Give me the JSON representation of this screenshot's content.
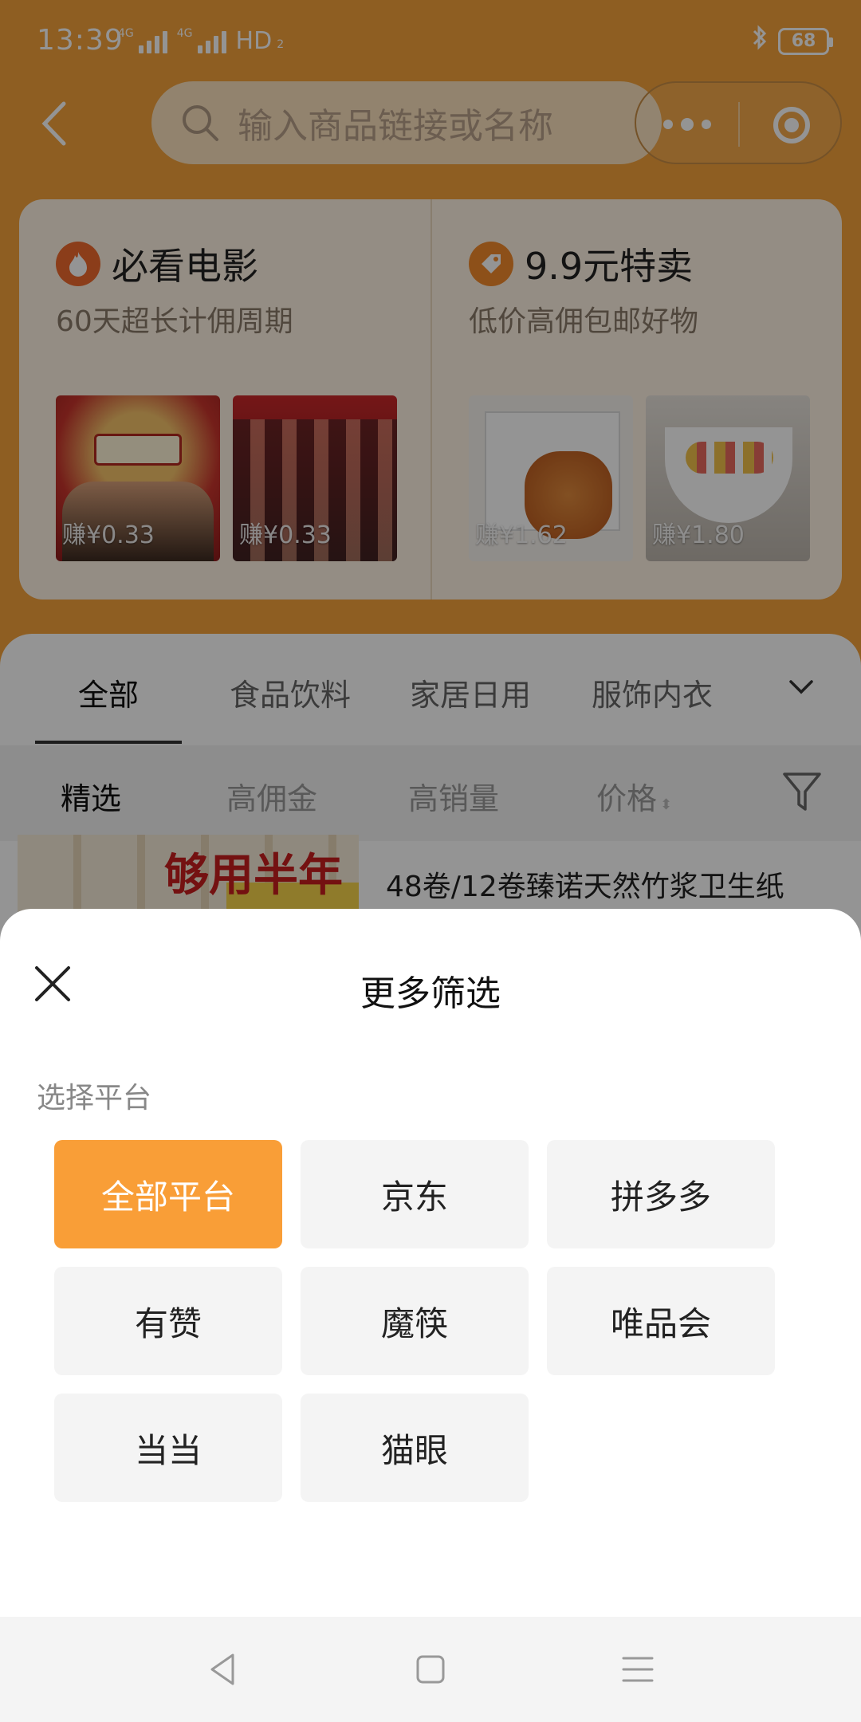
{
  "status_bar": {
    "time": "13:39",
    "network1": "4G",
    "network2": "4G",
    "hd": "HD",
    "sim": "2",
    "battery": "68"
  },
  "search": {
    "placeholder": "输入商品链接或名称"
  },
  "promos": [
    {
      "title": "必看电影",
      "subtitle": "60天超长计佣周期",
      "items": [
        {
          "earn": "赚¥0.33"
        },
        {
          "earn": "赚¥0.33"
        }
      ]
    },
    {
      "title": "9.9元特卖",
      "subtitle": "低价高佣包邮好物",
      "items": [
        {
          "earn": "赚¥1.62"
        },
        {
          "earn": "赚¥1.80"
        }
      ]
    }
  ],
  "category_tabs": [
    "全部",
    "食品饮料",
    "家居日用",
    "服饰内衣"
  ],
  "sort_options": [
    "精选",
    "高佣金",
    "高销量",
    "价格"
  ],
  "product": {
    "banner": "够用半年",
    "name": "48卷/12卷臻诺天然竹浆卫生纸"
  },
  "sheet": {
    "title": "更多筛选",
    "section_label": "选择平台",
    "platforms": [
      "全部平台",
      "京东",
      "拼多多",
      "有赞",
      "魔筷",
      "唯品会",
      "当当",
      "猫眼"
    ],
    "selected_platform": "全部平台"
  },
  "colors": {
    "accent": "#f99e37",
    "header_bg": "#f5a23c",
    "overlay": "rgba(0,0,0,0.42)"
  }
}
